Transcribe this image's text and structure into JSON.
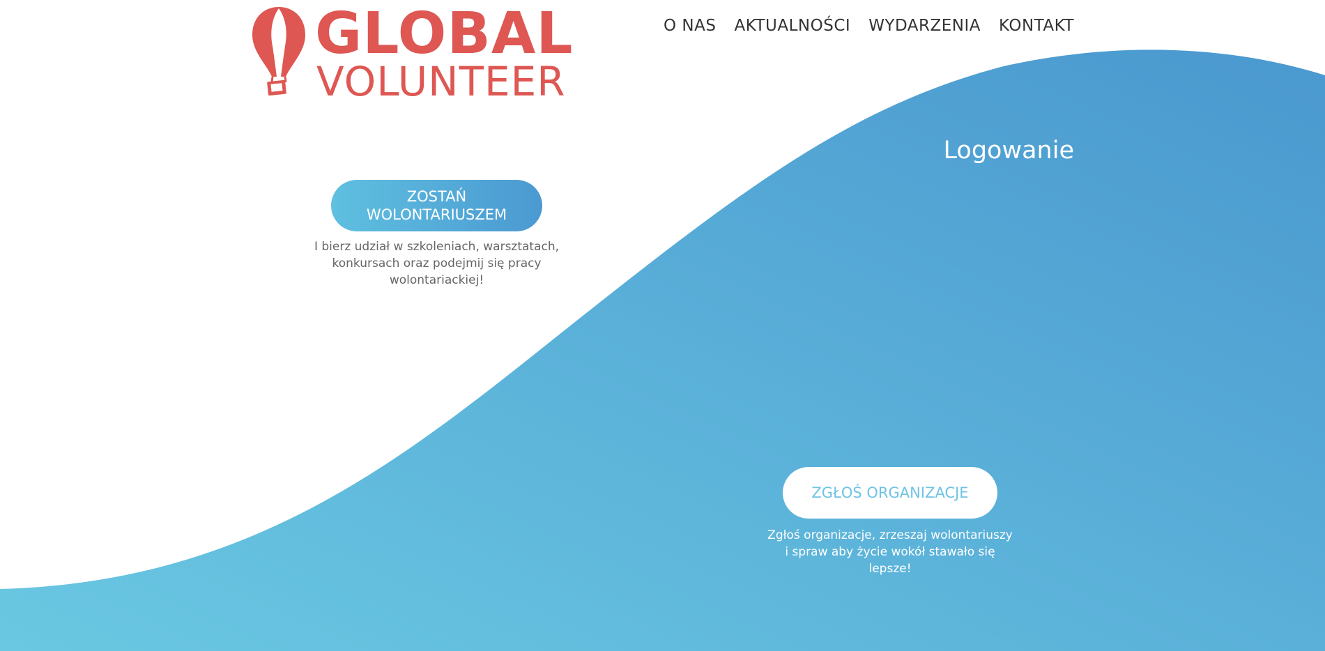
{
  "brand": {
    "word_1": "GLOBAL",
    "word_2": "VOLUNTEER",
    "color": "#de5753",
    "icon": "hot-air-balloon-icon"
  },
  "nav": {
    "items": [
      {
        "label": "O NAS"
      },
      {
        "label": "AKTUALNOŚCI"
      },
      {
        "label": "WYDARZENIA"
      },
      {
        "label": "KONTAKT"
      }
    ]
  },
  "login": {
    "title": "Logowanie"
  },
  "volunteer_cta": {
    "label": "ZOSTAŃ WOLONTARIUSZEM",
    "description": "I bierz udział w szkoleniach, warsztatach, konkursach oraz podejmij się pracy wolontariackiej!"
  },
  "organization_cta": {
    "label": "ZGŁOŚ ORGANIZACJE",
    "description": "Zgłoś organizacje, zrzeszaj wolontariuszy i spraw aby życie wokół stawało się lepsze!"
  },
  "colors": {
    "wave_light": "#6ac8e2",
    "wave_dark": "#4a98cf",
    "text_gray": "#666666"
  }
}
